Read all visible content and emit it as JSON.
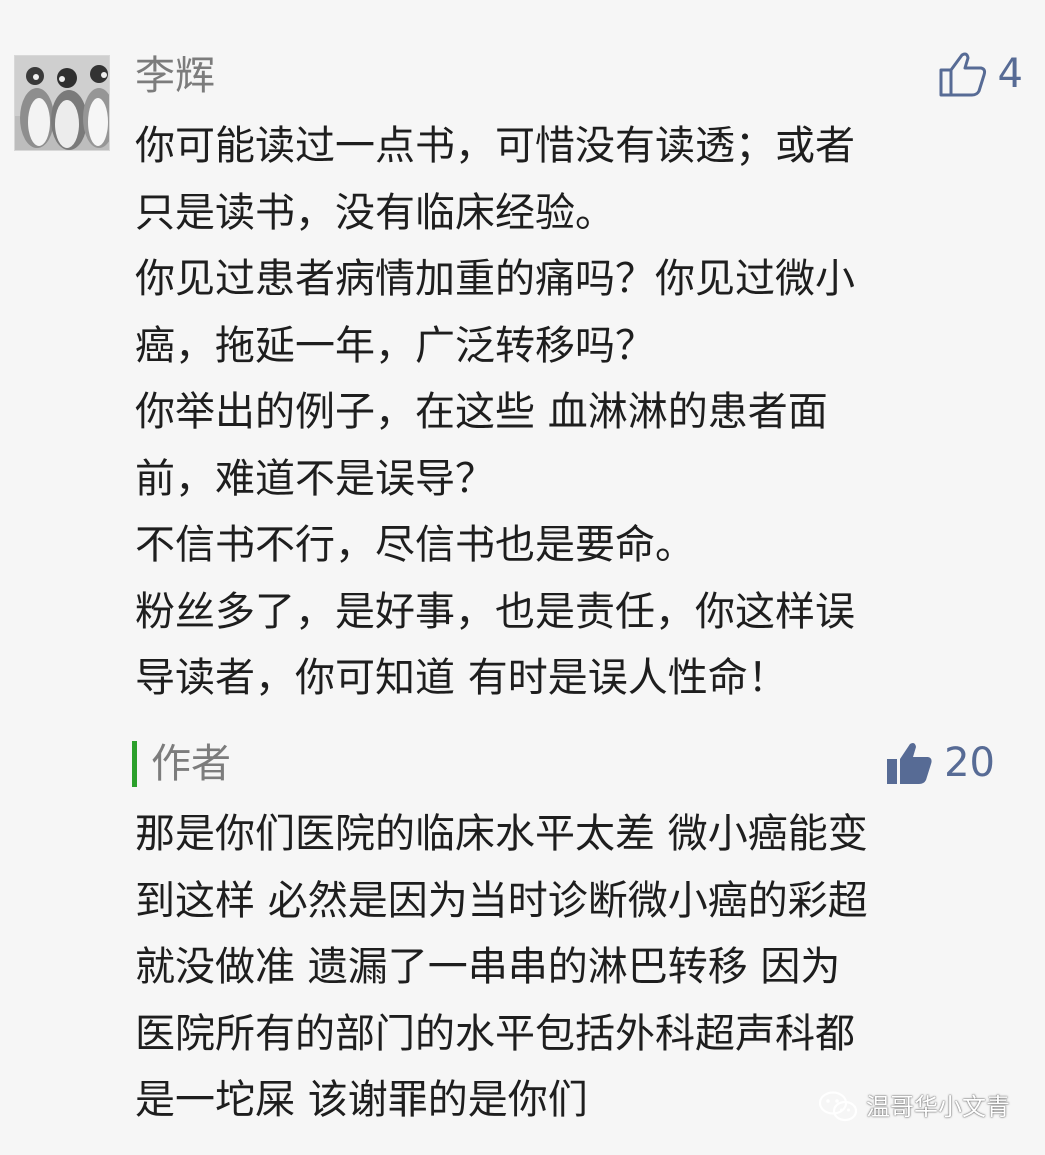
{
  "comments": [
    {
      "author": "李辉",
      "likes": "4",
      "liked": false,
      "lines": [
        "你可能读过一点书，可惜没有读透；或者",
        "只是读书，没有临床经验。",
        "你见过患者病情加重的痛吗？你见过微小",
        "癌，拖延一年，广泛转移吗？",
        "你举出的例子，在这些 血淋淋的患者面",
        "前，难道不是误导？",
        "不信书不行，尽信书也是要命。",
        "粉丝多了，是好事，也是责任，你这样误",
        "导读者，你可知道 有时是误人性命！"
      ],
      "reply": {
        "author": "作者",
        "likes": "20",
        "liked": true,
        "lines": [
          "那是你们医院的临床水平太差 微小癌能变",
          "到这样 必然是因为当时诊断微小癌的彩超",
          "就没做准 遗漏了一串串的淋巴转移 因为",
          "医院所有的部门的水平包括外科超声科都",
          "是一坨屎 该谢罪的是你们"
        ]
      }
    }
  ],
  "watermark": {
    "text": "温哥华小文青",
    "icon": "wechat-icon"
  },
  "colors": {
    "background": "#f6f6f6",
    "name": "#7c7c7c",
    "body_text": "#1e1e1e",
    "like_blue": "#576b95",
    "reply_bar": "#2ba02b"
  }
}
